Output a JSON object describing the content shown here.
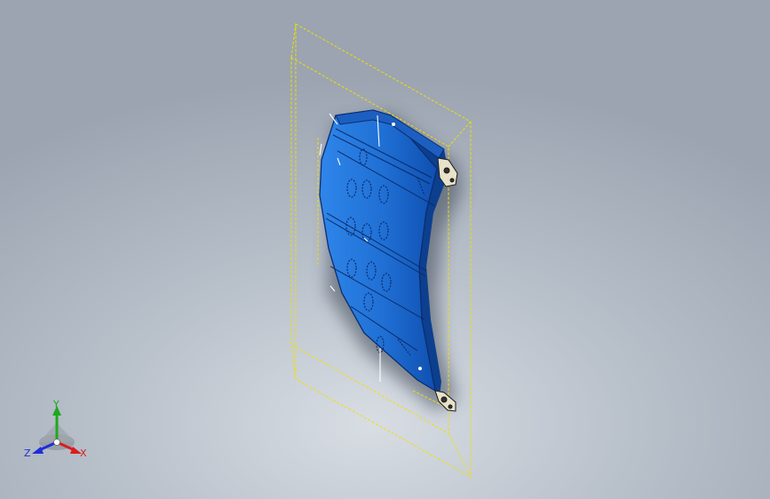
{
  "viewport": {
    "background_colors": [
      "#d8dde3",
      "#9ba4b0"
    ],
    "model_color": "#2f7fe0",
    "bbox_color": "#f0e000"
  },
  "triad": {
    "x_label": "X",
    "y_label": "Y",
    "z_label": "Z",
    "x_color": "#d81e1e",
    "y_color": "#1ea81e",
    "z_color": "#1e2ed8"
  }
}
